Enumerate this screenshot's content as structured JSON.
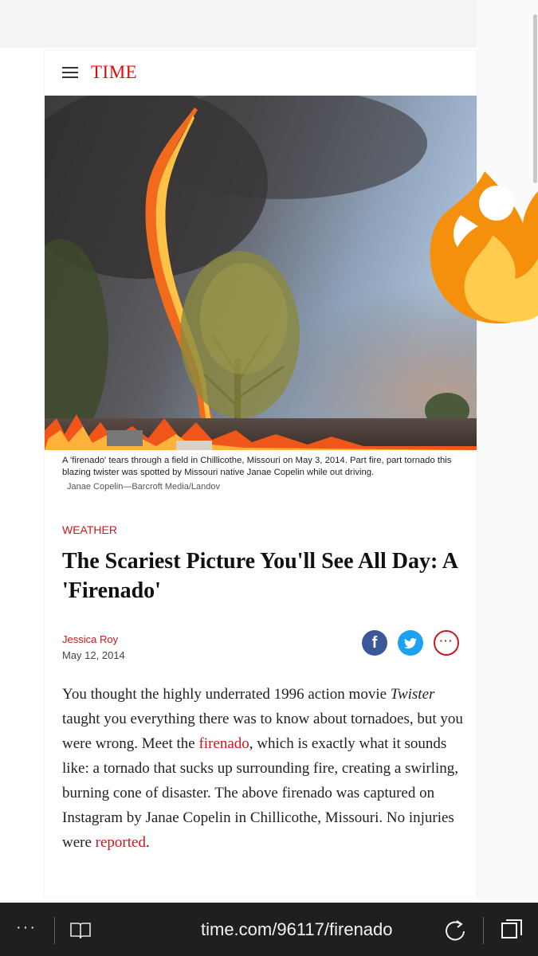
{
  "site": {
    "logo": "TIME",
    "menu_icon": "hamburger-icon",
    "brand_color": "#e90606"
  },
  "hero": {
    "caption": "A 'firenado' tears through a field in Chillicothe, Missouri on May 3, 2014. Part fire, part tornado this blazing twister was spotted by Missouri native Janae Copelin while out driving.",
    "credit": "Janae Copelin—Barcroft Media/Landov"
  },
  "article": {
    "kicker": "WEATHER",
    "headline": "The Scariest Picture You'll See All Day: A 'Firenado'",
    "author": "Jessica Roy",
    "date": "May 12, 2014",
    "share": {
      "facebook_icon": "facebook-icon",
      "facebook_glyph": "f",
      "twitter_icon": "twitter-icon",
      "more_icon": "more-icon",
      "more_glyph": "···"
    },
    "body": {
      "p1_before": "You thought the highly underrated 1996 action movie ",
      "p1_italic": "Twister",
      "p1_mid": " taught you everything there was to know about tornadoes, but you were wrong. Meet the ",
      "link1": "firenado",
      "p1_after": ", which is exactly what it sounds like: a tornado that sucks up surrounding fire, creating a swirling, burning cone of disaster. The above firenado was captured on Instagram by Janae Copelin in Chillicothe, Missouri. No injuries were ",
      "link2": "reported",
      "p1_end": "."
    },
    "accent_color": "#c8191e"
  },
  "overlay": {
    "emoji_icon": "fire-emoji-icon"
  },
  "browser": {
    "more_glyph": "···",
    "reading_view_icon": "reading-view-icon",
    "url": "time.com/96117/firenado",
    "refresh_icon": "refresh-icon",
    "tabs_icon": "tabs-icon"
  }
}
